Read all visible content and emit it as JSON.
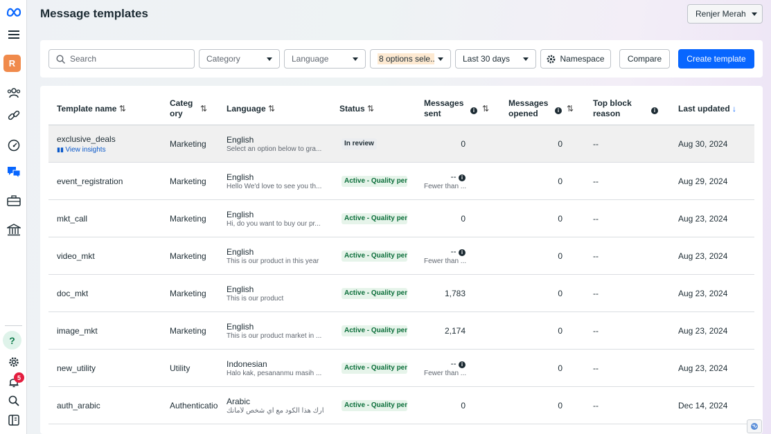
{
  "page": {
    "title": "Message templates",
    "user_name": "Renjer Merah"
  },
  "rail": {
    "avatar_letter": "R",
    "notification_count": "5",
    "help_label": "?"
  },
  "toolbar": {
    "search_placeholder": "Search",
    "category_label": "Category",
    "language_label": "Language",
    "status_label": "8 options sele...",
    "date_range_label": "Last 30 days",
    "namespace_label": "Namespace",
    "compare_label": "Compare",
    "create_label": "Create template"
  },
  "table": {
    "headers": {
      "name": "Template name",
      "category": "Categ ory",
      "category_l1": "Categ",
      "category_l2": "ory",
      "language": "Language",
      "status": "Status",
      "sent_l1": "Messages",
      "sent_l2": "sent",
      "opened_l1": "Messages",
      "opened_l2": "opened",
      "block_l1": "Top block",
      "block_l2": "reason",
      "updated": "Last updated"
    },
    "rows": [
      {
        "name": "exclusive_deals",
        "insights": "View insights",
        "category": "Marketing",
        "language": "English",
        "preview": "Select an option below to gra...",
        "status": "In review",
        "sent": "0",
        "sent_note": "",
        "opened": "0",
        "block": "--",
        "updated": "Aug 30, 2024"
      },
      {
        "name": "event_registration",
        "insights": "",
        "category": "Marketing",
        "language": "English",
        "preview": "Hello We'd love to see you th...",
        "status": "Active - Quality pen",
        "sent": "--",
        "sent_note": "Fewer than ...",
        "opened": "0",
        "block": "--",
        "updated": "Aug 29, 2024"
      },
      {
        "name": "mkt_call",
        "insights": "",
        "category": "Marketing",
        "language": "English",
        "preview": "Hi, do you want to buy our pr...",
        "status": "Active - Quality pen",
        "sent": "0",
        "sent_note": "",
        "opened": "0",
        "block": "--",
        "updated": "Aug 23, 2024"
      },
      {
        "name": "video_mkt",
        "insights": "",
        "category": "Marketing",
        "language": "English",
        "preview": "This is our product in this year",
        "status": "Active - Quality pen",
        "sent": "--",
        "sent_note": "Fewer than ...",
        "opened": "0",
        "block": "--",
        "updated": "Aug 23, 2024"
      },
      {
        "name": "doc_mkt",
        "insights": "",
        "category": "Marketing",
        "language": "English",
        "preview": "This is our product",
        "status": "Active - Quality pen",
        "sent": "1,783",
        "sent_note": "",
        "opened": "0",
        "block": "--",
        "updated": "Aug 23, 2024"
      },
      {
        "name": "image_mkt",
        "insights": "",
        "category": "Marketing",
        "language": "English",
        "preview": "This is our product market in ...",
        "status": "Active - Quality pen",
        "sent": "2,174",
        "sent_note": "",
        "opened": "0",
        "block": "--",
        "updated": "Aug 23, 2024"
      },
      {
        "name": "new_utility",
        "insights": "",
        "category": "Utility",
        "language": "Indonesian",
        "preview": "Halo kak, pesananmu masih ...",
        "status": "Active - Quality pen",
        "sent": "--",
        "sent_note": "Fewer than ...",
        "opened": "0",
        "block": "--",
        "updated": "Aug 23, 2024"
      },
      {
        "name": "auth_arabic",
        "insights": "",
        "category": "Authentication",
        "language": "Arabic",
        "preview": "لا تشارك هذا الكود مع أي شخص لأمانك...",
        "status": "Active - Quality pen",
        "sent": "0",
        "sent_note": "",
        "opened": "0",
        "block": "--",
        "updated": "Dec 14, 2024"
      }
    ]
  },
  "colors": {
    "accent": "#0866ff",
    "status_active_bg": "#e6f4ea",
    "status_active_text": "#0b6e3a",
    "status_review_bg": "#ebedf0",
    "avatar_bg": "#f08a4b"
  }
}
